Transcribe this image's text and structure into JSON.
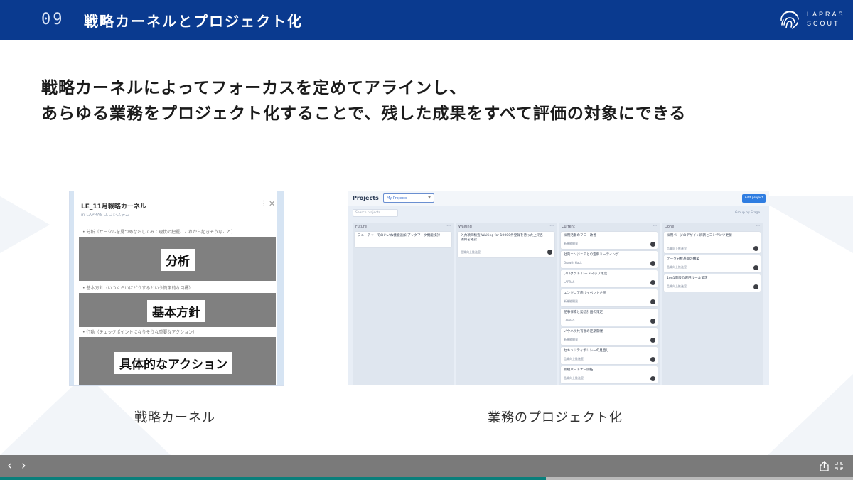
{
  "header": {
    "slide_number": "09",
    "title": "戦略カーネルとプロジェクト化",
    "logo_line1": "LAPRAS",
    "logo_line2": "SCOUT"
  },
  "headline": {
    "line1": "戦略カーネルによってフォーカスを定めてアラインし、",
    "line2": "あらゆる業務をプロジェクト化することで、残した成果をすべて評価の対象にできる"
  },
  "kernel": {
    "doc_title": "LE_11月戦略カーネル",
    "doc_subtitle": "in LAPRAS エコシステム",
    "sections": [
      {
        "label": "• 分析（サークルを見つめなおしてみて現状の把握、これから起きそうなこと）",
        "tag": "分析"
      },
      {
        "label": "• 基本方針（いつくらいにどうするという簡潔的な目標）",
        "tag": "基本方針"
      },
      {
        "label": "• 行動（チェックポイントになりそうな重要なアクション）",
        "tag": "具体的なアクション"
      }
    ],
    "caption": "戦略カーネル"
  },
  "board": {
    "title": "Projects",
    "select_value": "My Projects",
    "add_button": "Add project",
    "search_placeholder": "Search projects",
    "group_by": "Group by  Stage",
    "caption": "業務のプロジェクト化",
    "columns": [
      {
        "name": "Future",
        "cards": [
          {
            "title": "フューチャーでのいいね機能追加 ブックマーク機能検討",
            "meta": ""
          }
        ]
      },
      {
        "name": "Waiting",
        "cards": [
          {
            "title": "入力項目精査 Waiting for 10000件登録を待った上で各項目を確認",
            "meta": "品質向上推進室"
          }
        ]
      },
      {
        "name": "Current",
        "cards": [
          {
            "title": "採用活動のフロー改善",
            "meta": "新機能開発"
          },
          {
            "title": "社内エンジニアとの定例ミーティング",
            "meta": "Growth Hack"
          },
          {
            "title": "プロダクト ロードマップ策定",
            "meta": "LAPRAS"
          },
          {
            "title": "エンジニア向けイベント企画",
            "meta": "新機能開発"
          },
          {
            "title": "記事作成と発信計画の策定",
            "meta": "LAPRAS"
          },
          {
            "title": "ノウハウ共有会の定期開催",
            "meta": "新機能開発"
          },
          {
            "title": "セキュリティポリシーの見直し",
            "meta": "品質向上推進室"
          },
          {
            "title": "新規パートナー開拓",
            "meta": "品質向上推進室"
          }
        ]
      },
      {
        "name": "Done",
        "cards": [
          {
            "title": "採用ページのデザイン刷新とコンテンツ更新",
            "meta": "品質向上推進室"
          },
          {
            "title": "データ分析基盤の構築",
            "meta": "品質向上推進室"
          },
          {
            "title": "1on1面談の運用ルール策定",
            "meta": "品質向上推進室"
          }
        ]
      }
    ]
  },
  "nav": {
    "prev": "‹",
    "next": "›"
  },
  "progress": {
    "fraction": 0.64
  },
  "colors": {
    "header_bg": "#0a3a8f",
    "block_gray": "#808080",
    "progress_fill": "#0a7f7b",
    "bottom_bar": "#7a7a7a"
  }
}
